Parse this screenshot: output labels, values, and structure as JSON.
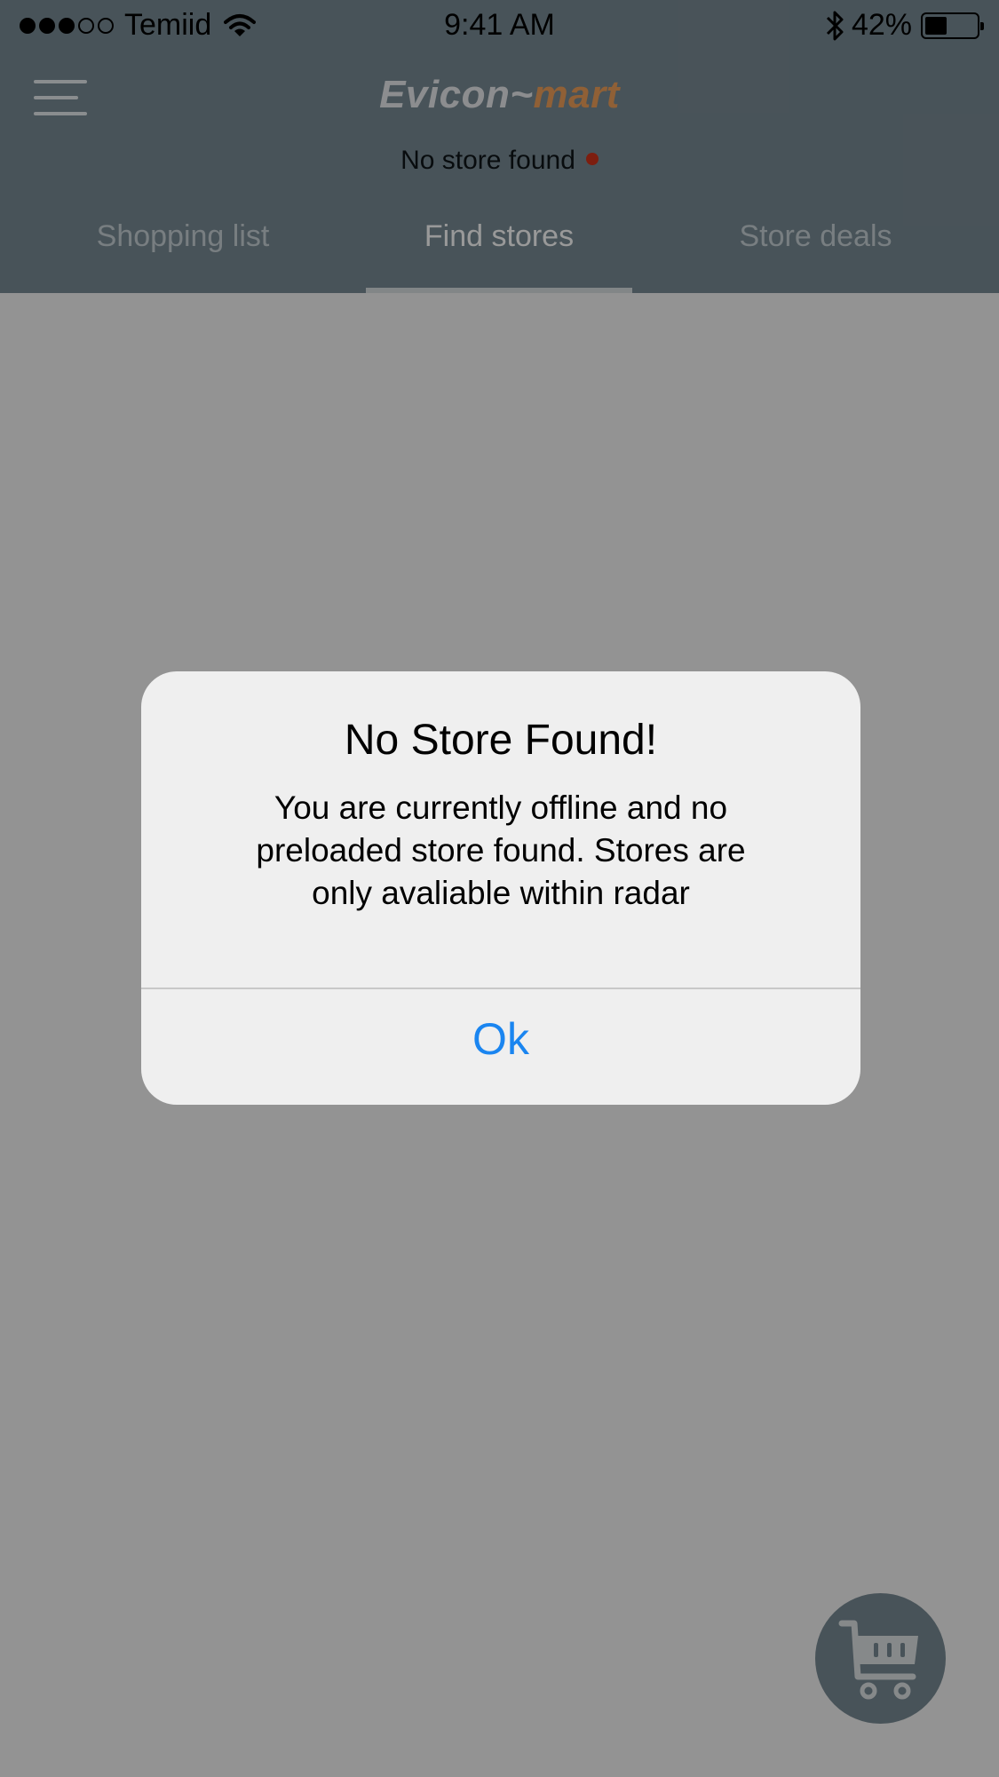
{
  "status_bar": {
    "signal_filled": 3,
    "signal_total": 5,
    "carrier": "Temiid",
    "wifi_icon": "wifi-icon",
    "time": "9:41 AM",
    "bluetooth_icon": "bluetooth-icon",
    "battery_percent_label": "42%",
    "battery_level": 0.42
  },
  "app_bar": {
    "menu_icon": "hamburger-menu-icon",
    "brand_part1": "Evicon~",
    "brand_part2": "mart",
    "store_status": "No store found",
    "status_dot_color": "#d0331a"
  },
  "tabs": [
    {
      "label": "Shopping list",
      "active": false
    },
    {
      "label": "Find stores",
      "active": true
    },
    {
      "label": "Store deals",
      "active": false
    }
  ],
  "alert": {
    "title": "No Store Found!",
    "message": "You are currently offline and no preloaded store found. Stores are only avaliable within radar",
    "ok_label": "Ok"
  },
  "fab": {
    "icon": "shopping-cart-icon"
  },
  "colors": {
    "header_bg": "#798b94",
    "brand_accent": "#f0a05a",
    "link_blue": "#1a85f0",
    "alert_bg": "#efefef"
  }
}
